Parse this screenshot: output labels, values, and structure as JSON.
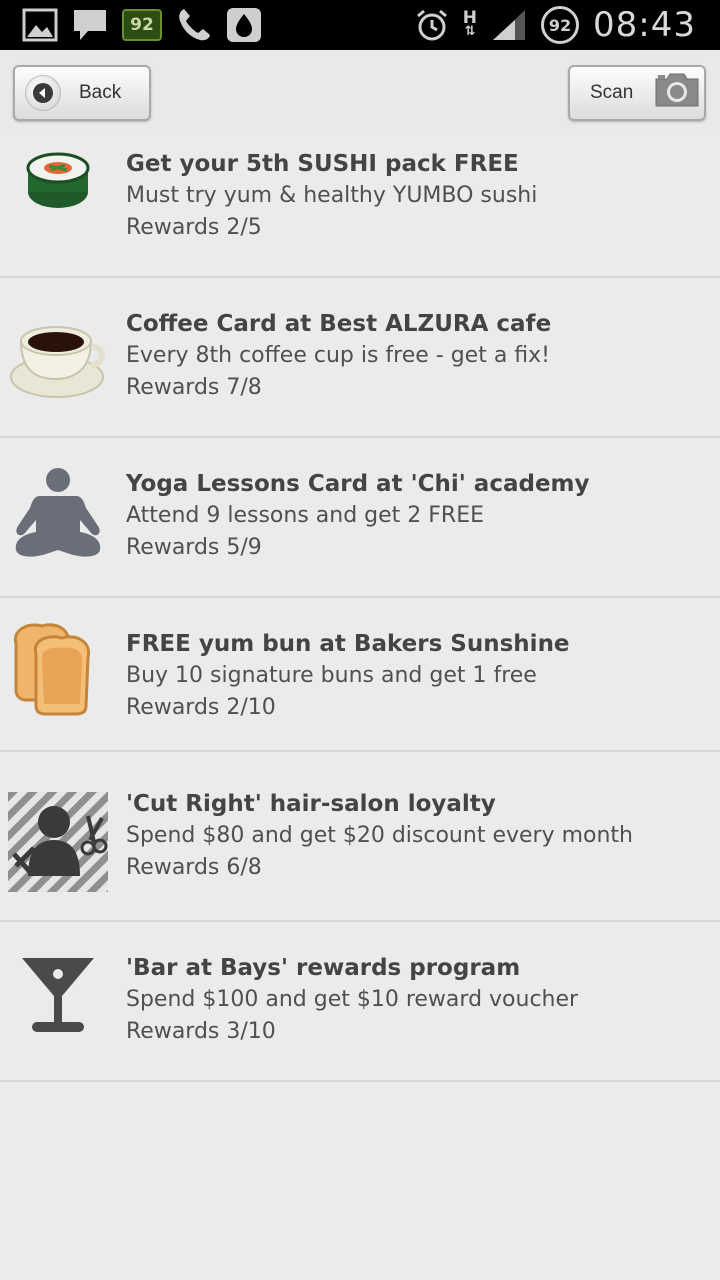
{
  "status_bar": {
    "badge_value": "92",
    "battery_value": "92",
    "signal_label": "H",
    "time": "08:43"
  },
  "toolbar": {
    "back_label": "Back",
    "scan_label": "Scan"
  },
  "cards": [
    {
      "icon": "sushi-roll-icon",
      "title": "Get your 5th SUSHI pack FREE",
      "description": "Must try yum & healthy YUMBO sushi",
      "rewards": "Rewards 2/5"
    },
    {
      "icon": "coffee-cup-icon",
      "title": "Coffee Card at Best ALZURA cafe",
      "description": "Every 8th coffee cup is free - get a fix!",
      "rewards": "Rewards 7/8"
    },
    {
      "icon": "yoga-person-icon",
      "title": "Yoga Lessons Card at 'Chi' academy",
      "description": "Attend 9 lessons and get 2 FREE",
      "rewards": "Rewards 5/9"
    },
    {
      "icon": "toast-bread-icon",
      "title": "FREE yum bun at Bakers Sunshine",
      "description": "Buy 10 signature buns and get 1 free",
      "rewards": "Rewards 2/10"
    },
    {
      "icon": "hair-salon-icon",
      "title": "'Cut Right' hair-salon loyalty",
      "description": "Spend $80 and get $20 discount every month",
      "rewards": "Rewards 6/8"
    },
    {
      "icon": "cocktail-glass-icon",
      "title": "'Bar at Bays' rewards program",
      "description": "Spend $100 and get $10 reward voucher",
      "rewards": "Rewards 3/10"
    }
  ]
}
